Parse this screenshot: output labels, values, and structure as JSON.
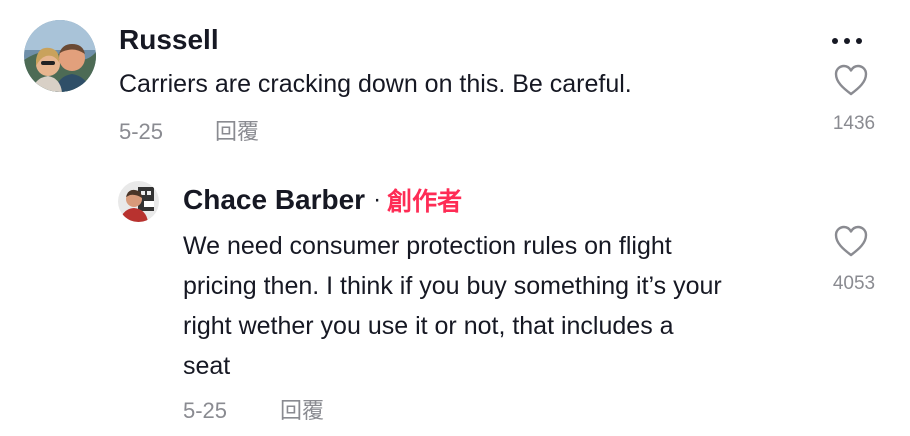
{
  "comment": {
    "username": "Russell",
    "text": "Carriers are cracking down on this. Be careful.",
    "date": "5-25",
    "reply_label": "回覆",
    "like_count": "1436"
  },
  "reply": {
    "username": "Chace Barber",
    "separator": "·",
    "creator_badge": "創作者",
    "text_lines": [
      "We need consumer protection rules on flight",
      "pricing then. I think if you buy something it’s your",
      "right wether you use it or not, that includes a",
      "seat"
    ],
    "date": "5-25",
    "reply_label": "回覆",
    "like_count": "4053"
  },
  "icons": {
    "more": "more-dots-icon",
    "like": "heart-outline-icon"
  }
}
